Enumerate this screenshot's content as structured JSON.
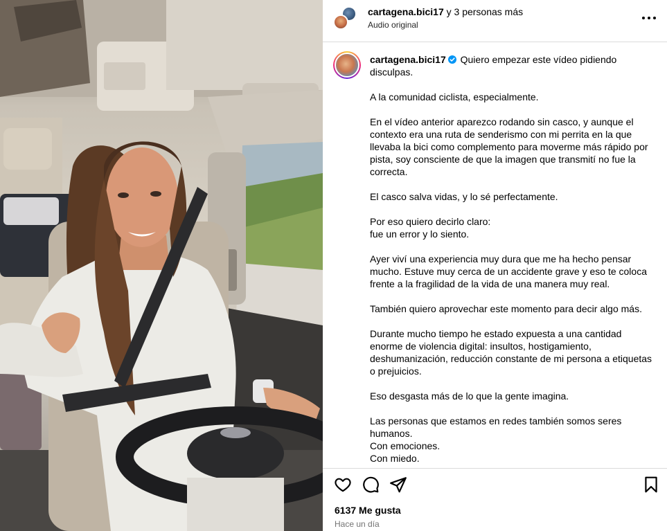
{
  "media": {
    "alt_subject": ""
  },
  "header": {
    "username": "cartagena.bici17",
    "collab_suffix": "y 3 personas más",
    "audio": "Audio original"
  },
  "caption": {
    "username": "cartagena.bici17",
    "text": " Quiero empezar este vídeo pidiendo\ndisculpas.\n\nA la comunidad ciclista, especialmente.\n\nEn el vídeo anterior aparezco rodando sin casco, y aunque el\ncontexto era una ruta de senderismo con mi perrita en la que\nllevaba la bici como complemento para moverme más rápido por\npista, soy consciente de que la imagen que transmití no fue la\ncorrecta.\n\nEl casco salva vidas, y lo sé perfectamente.\n\nPor eso quiero decirlo claro:\nfue un error y lo siento.\n\nAyer viví una experiencia muy dura que me ha hecho pensar\nmucho. Estuve muy cerca de un accidente grave y eso te coloca\nfrente a la fragilidad de la vida de una manera muy real.\n\nTambién quiero aprovechar este momento para decir algo más.\n\nDurante mucho tiempo he estado expuesta a una cantidad\nenorme de violencia digital: insultos, hostigamiento,\ndeshumanización, reducción constante de mi persona a etiquetas\no prejuicios.\n\nEso desgasta más de lo que la gente imagina.\n\nLas personas que estamos en redes también somos seres\nhumanos.\nCon emociones.\nCon miedo."
  },
  "footer": {
    "likes": "6137 Me gusta",
    "time": "Hace un día"
  },
  "icons": {
    "like": "heart-icon",
    "comment": "comment-icon",
    "share": "share-icon",
    "save": "bookmark-icon",
    "more": "more-icon",
    "verified": "verified-badge-icon"
  },
  "colors": {
    "verified": "#0095f6",
    "border": "#dbdbdb",
    "secondary_text": "#737373"
  }
}
